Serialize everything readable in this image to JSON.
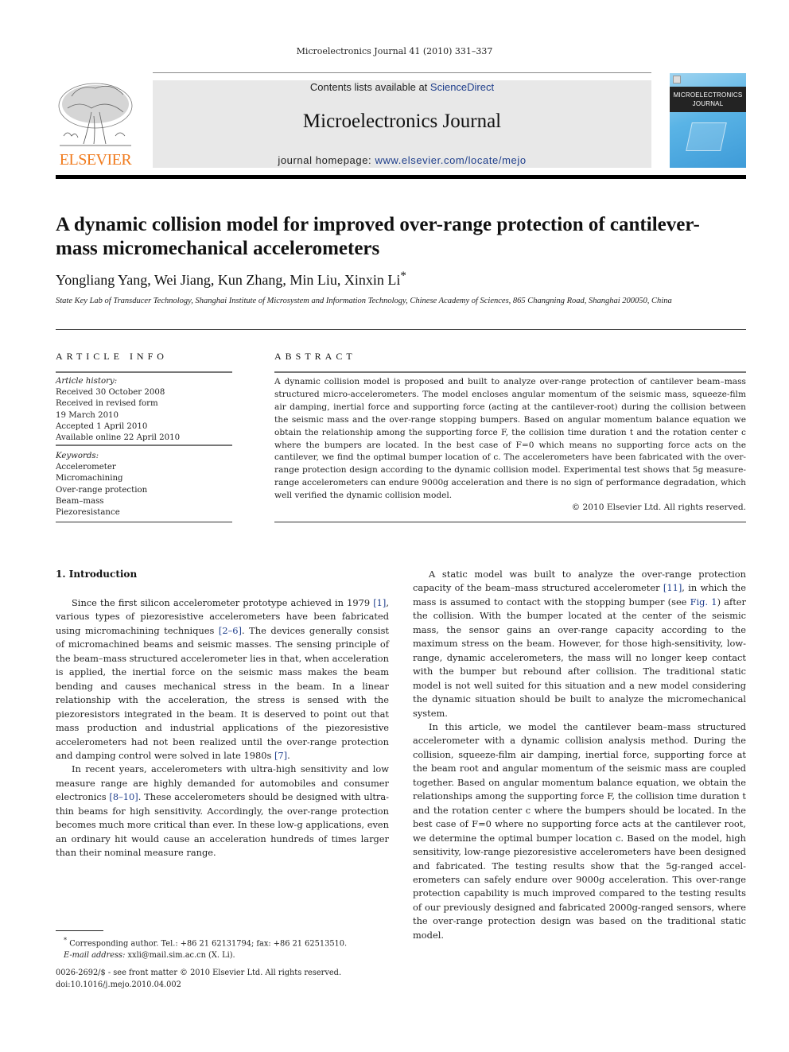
{
  "running_head": "Microelectronics Journal 41 (2010) 331–337",
  "publisher": {
    "logo_icon": "elsevier-tree-icon",
    "name": "ELSEVIER",
    "brand_color": "#f07b1e"
  },
  "masthead": {
    "contents_prefix": "Contents lists available at ",
    "contents_link": "ScienceDirect",
    "journal_name": "Microelectronics Journal",
    "homepage_prefix": "journal homepage: ",
    "homepage_link": "www.elsevier.com/locate/mejo",
    "link_color": "#1f3f8c"
  },
  "cover": {
    "line1": "MICROELECTRONICS",
    "line2": "JOURNAL"
  },
  "article": {
    "title": "A dynamic collision model for improved over-range protection of cantilever-mass micromechanical accelerometers",
    "authors": "Yongliang Yang, Wei Jiang, Kun Zhang, Min Liu, Xinxin Li",
    "corresponding_mark": "*",
    "affiliation": "State Key Lab of Transducer Technology, Shanghai Institute of Microsystem and Information Technology, Chinese Academy of Sciences, 865 Changning Road, Shanghai 200050, China"
  },
  "article_info": {
    "heading": "ARTICLE INFO",
    "history_label": "Article history:",
    "history": [
      "Received 30 October 2008",
      "Received in revised form",
      "19 March 2010",
      "Accepted 1 April 2010",
      "Available online 22 April 2010"
    ],
    "keywords_label": "Keywords:",
    "keywords": [
      "Accelerometer",
      "Micromachining",
      "Over-range protection",
      "Beam–mass",
      "Piezoresistance"
    ]
  },
  "abstract": {
    "heading": "ABSTRACT",
    "text": "A dynamic collision model is proposed and built to analyze over-range protection of cantilever beam–mass structured micro-accelerometers. The model encloses angular momentum of the seismic mass, squeeze-film air damping, inertial force and supporting force (acting at the cantilever-root) during the collision between the seismic mass and the over-range stopping bumpers. Based on angular momentum balance equation we obtain the relationship among the supporting force F, the collision time duration t and the rotation center c where the bumpers are located. In the best case of F=0 which means no supporting force acts on the cantilever, we find the optimal bumper location of c. The accelerometers have been fabricated with the over-range protection design according to the dynamic collision model. Experimental test shows that 5g measure-range accelerometers can endure 9000g acceleration and there is no sign of performance degradation, which well verified the dynamic collision model.",
    "copyright": "© 2010 Elsevier Ltd. All rights reserved."
  },
  "body": {
    "section_heading": "1.  Introduction",
    "left_paragraphs": [
      "Since the first silicon accelerometer prototype achieved in 1979 [1], various types of piezoresistive accelerometers have been fabricated using micromachining techniques [2–6]. The devices generally consist of micromachined beams and seismic masses. The sensing principle of the beam–mass structured accelerometer lies in that, when acceleration is applied, the inertial force on the seismic mass makes the beam bending and causes mechanical stress in the beam. In a linear relationship with the acceleration, the stress is sensed with the piezoresistors integrated in the beam. It is deserved to point out that mass production and industrial applications of the piezoresistive accelerometers had not been realized until the over-range protection and damping control were solved in late 1980s [7].",
      "In recent years, accelerometers with ultra-high sensitivity and low measure range are highly demanded for automobiles and consumer electronics [8–10]. These accelerometers should be designed with ultra-thin beams for high sensitivity. Accordingly, the over-range protection becomes much more critical than ever. In these low-g applications, even an ordinary hit would cause an acceleration hundreds of times larger than their nominal measure range."
    ],
    "right_paragraphs": [
      "A static model was built to analyze the over-range protection capacity of the beam–mass structured accelerometer [11], in which the mass is assumed to contact with the stopping bumper (see Fig. 1) after the collision. With the bumper located at the center of the seismic mass, the sensor gains an over-range capacity according to the maximum stress on the beam. However, for those high-sensitivity, low-range, dynamic accelerometers, the mass will no longer keep contact with the bumper but rebound after collision. The traditional static model is not well suited for this situation and a new model considering the dynamic situation should be built to analyze the micromechanical system.",
      "In this article, we model the cantilever beam–mass structured accelerometer with a dynamic collision analysis method. During the collision, squeeze-film air damping, inertial force, supporting force at the beam root and angular momentum of the seismic mass are coupled together. Based on angular momentum balance equation, we obtain the relationships among the supporting force F, the collision time duration t and the rotation center c where the bumpers should be located. In the best case of F=0 where no supporting force acts at the cantilever root, we determine the optimal bumper location c. Based on the model, high sensitivity, low-range piezoresistive accelerometers have been designed and fabricated. The testing results show that the 5g-ranged accel-erometers can safely endure over 9000g acceleration. This over-range protection capability is much improved compared to the testing results of our previously designed and fabricated 2000g-ranged sensors, where the over-range protection design was based on the traditional static model."
    ],
    "citations": [
      "[1]",
      "[2–6]",
      "[7]",
      "[8–10]",
      "[11]",
      "Fig. 1"
    ]
  },
  "footnote": {
    "mark": "*",
    "corresponding": "Corresponding author. Tel.: +86 21 62131794; fax: +86 21 62513510.",
    "email_label": "E-mail address:",
    "email": "xxli@mail.sim.ac.cn (X. Li)."
  },
  "front_matter": {
    "issn_line": "0026-2692/$ - see front matter © 2010 Elsevier Ltd. All rights reserved.",
    "doi": "doi:10.1016/j.mejo.2010.04.002"
  }
}
